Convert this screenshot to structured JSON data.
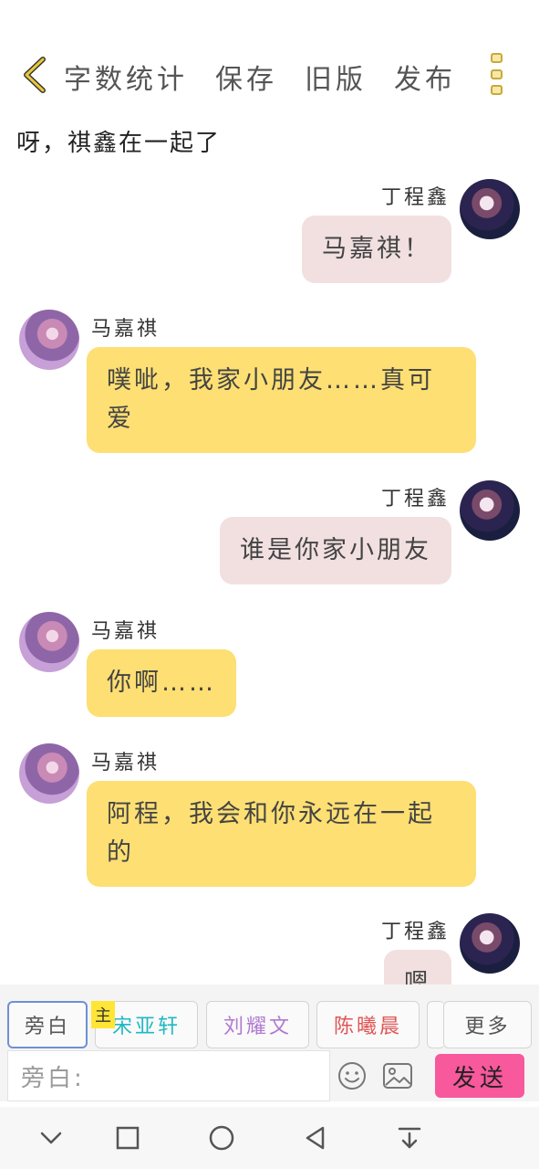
{
  "toolbar": {
    "links": [
      "字数统计",
      "保存",
      "旧版",
      "发布"
    ]
  },
  "chapter_title": "呀，祺鑫在一起了",
  "messages": [
    {
      "speaker": "丁程鑫",
      "text": "马嘉祺！"
    },
    {
      "speaker": "马嘉祺",
      "text": "噗呲，我家小朋友……真可爱"
    },
    {
      "speaker": "丁程鑫",
      "text": "谁是你家小朋友"
    },
    {
      "speaker": "马嘉祺",
      "text": "你啊……"
    },
    {
      "speaker": "马嘉祺",
      "text": "阿程，我会和你永远在一起的"
    },
    {
      "speaker": "丁程鑫",
      "text": "嗯"
    }
  ],
  "roles": {
    "narration": "旁白",
    "badge": "主",
    "role1": "宋亚轩",
    "role2": "刘耀文",
    "role3": "陈曦晨",
    "more": "更多"
  },
  "role_colors": {
    "role1": "#20b8c4",
    "role2": "#b07ad0",
    "role3": "#e05555"
  },
  "input": {
    "prefix": "旁白:",
    "send": "发送"
  },
  "colors": {
    "bubble_self": "#f2e0e1",
    "bubble_other": "#fddf73",
    "send_button": "#f8589c",
    "accent_back": "#c9a93a"
  }
}
